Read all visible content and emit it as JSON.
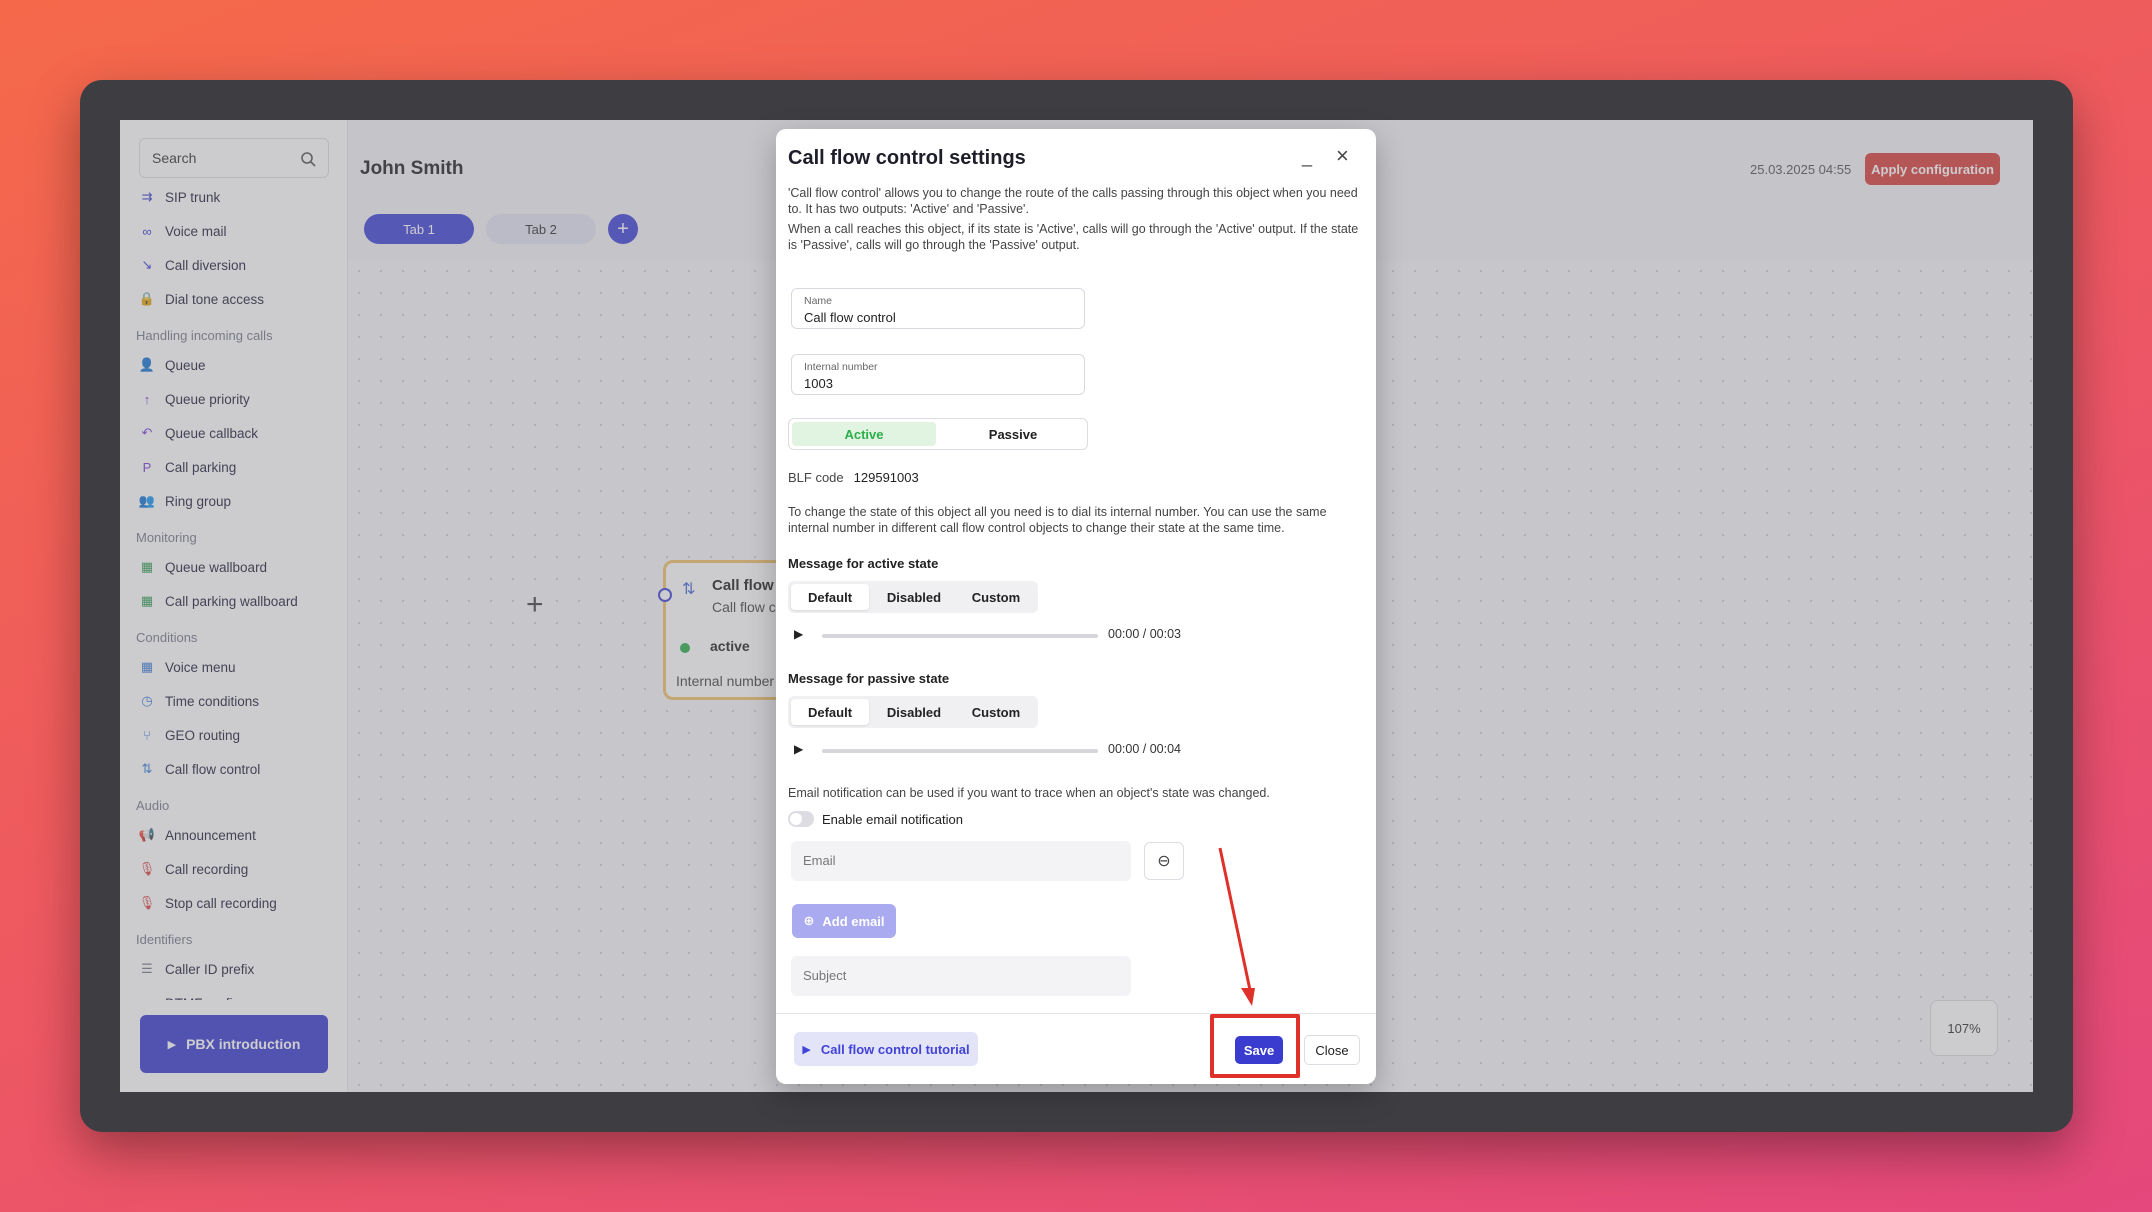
{
  "app": {
    "user_name": "John Smith",
    "datetime": "25.03.2025 04:55",
    "apply_label": "Apply configuration",
    "zoom": "107%",
    "tabs": [
      {
        "label": "Tab 1"
      },
      {
        "label": "Tab 2"
      }
    ],
    "add_tab_icon": "plus-circle-icon"
  },
  "sidebar": {
    "search_placeholder": "Search",
    "groups": [
      {
        "items": [
          {
            "label": "SIP trunk",
            "icon": "sip-trunk-icon",
            "color": "#3a3ccf"
          },
          {
            "label": "Voice mail",
            "icon": "voicemail-icon",
            "color": "#3a3ccf"
          },
          {
            "label": "Call diversion",
            "icon": "diversion-icon",
            "color": "#3a3ccf"
          },
          {
            "label": "Dial tone access",
            "icon": "lock-icon",
            "color": "#3a3ccf"
          }
        ]
      },
      {
        "header": "Handling incoming calls",
        "items": [
          {
            "label": "Queue",
            "icon": "queue-icon",
            "color": "#7b3fd6"
          },
          {
            "label": "Queue priority",
            "icon": "arrow-up-icon",
            "color": "#7b3fd6"
          },
          {
            "label": "Queue callback",
            "icon": "callback-icon",
            "color": "#7b3fd6"
          },
          {
            "label": "Call parking",
            "icon": "parking-icon",
            "color": "#7b3fd6"
          },
          {
            "label": "Ring group",
            "icon": "group-icon",
            "color": "#7b3fd6"
          }
        ]
      },
      {
        "header": "Monitoring",
        "items": [
          {
            "label": "Queue wallboard",
            "icon": "wallboard-icon",
            "color": "#2e9a4e"
          },
          {
            "label": "Call parking wallboard",
            "icon": "wallboard-icon",
            "color": "#2e9a4e"
          }
        ]
      },
      {
        "header": "Conditions",
        "items": [
          {
            "label": "Voice menu",
            "icon": "menu-grid-icon",
            "color": "#3a7bd6"
          },
          {
            "label": "Time conditions",
            "icon": "clock-icon",
            "color": "#3a7bd6"
          },
          {
            "label": "GEO routing",
            "icon": "geo-routing-icon",
            "color": "#3a7bd6"
          },
          {
            "label": "Call flow control",
            "icon": "flow-control-icon",
            "color": "#3a7bd6"
          }
        ]
      },
      {
        "header": "Audio",
        "items": [
          {
            "label": "Announcement",
            "icon": "megaphone-icon",
            "color": "#d9413b"
          },
          {
            "label": "Call recording",
            "icon": "mic-icon",
            "color": "#d9413b"
          },
          {
            "label": "Stop call recording",
            "icon": "mic-off-icon",
            "color": "#d9413b"
          }
        ]
      },
      {
        "header": "Identifiers",
        "items": [
          {
            "label": "Caller ID prefix",
            "icon": "list-icon",
            "color": "#777a88"
          },
          {
            "label": "DTMF prefix",
            "icon": "code-icon",
            "color": "#777a88"
          }
        ]
      }
    ],
    "pbx_intro": "PBX introduction"
  },
  "node": {
    "title": "Call flow c",
    "subtitle": "Call flow c",
    "state": "active",
    "internal": "Internal number"
  },
  "modal": {
    "title": "Call flow control settings",
    "intro1": "'Call flow control' allows you to change the route of the calls passing through this object when you need to. It has two outputs: 'Active' and 'Passive'.",
    "intro2": "When a call reaches this object, if its state is 'Active', calls will go through the 'Active' output. If the state is 'Passive', calls will go through the 'Passive' output.",
    "name_label": "Name",
    "name_value": "Call flow control",
    "internal_label": "Internal number",
    "internal_value": "1003",
    "state_active": "Active",
    "state_passive": "Passive",
    "blf_label": "BLF code",
    "blf_value": "129591003",
    "state_note": "To change the state of this object all you need is to dial its internal number. You can use the same internal number in different call flow control objects to change their state at the same time.",
    "active_msg_title": "Message for active state",
    "passive_msg_title": "Message for passive state",
    "msg_options": [
      "Default",
      "Disabled",
      "Custom"
    ],
    "active_time": "00:00 / 00:03",
    "passive_time": "00:00 / 00:04",
    "email_note": "Email notification can be used if you want to trace when an object's state was changed.",
    "enable_email": "Enable email notification",
    "email_placeholder": "Email",
    "add_email": "Add email",
    "subject_placeholder": "Subject",
    "tutorial": "Call flow control tutorial",
    "save": "Save",
    "close": "Close"
  }
}
